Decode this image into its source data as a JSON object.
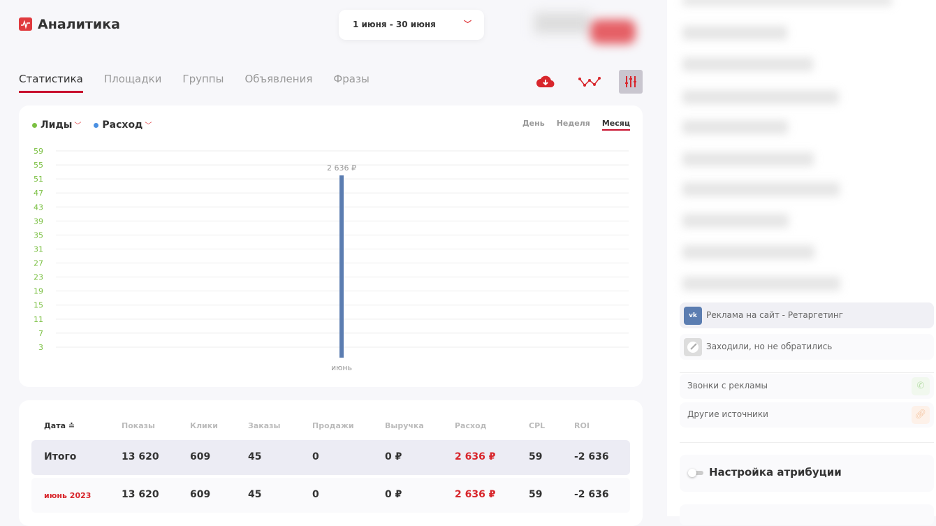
{
  "app": {
    "title": "Аналитика",
    "date_range": "1 июня - 30 июня"
  },
  "tabs": [
    {
      "label": "Статистика",
      "active": true
    },
    {
      "label": "Площадки"
    },
    {
      "label": "Группы"
    },
    {
      "label": "Объявления"
    },
    {
      "label": "Фразы"
    }
  ],
  "toolbar": {
    "icons": [
      "cloud-download-icon",
      "trend-line-icon",
      "sliders-icon"
    ]
  },
  "chart": {
    "legend": [
      {
        "label": "Лиды",
        "color": "#7bc043"
      },
      {
        "label": "Расход",
        "color": "#4a90e2"
      }
    ],
    "periods": [
      {
        "label": "День"
      },
      {
        "label": "Неделя"
      },
      {
        "label": "Месяц",
        "active": true
      }
    ]
  },
  "chart_data": {
    "type": "bar",
    "categories": [
      "июнь"
    ],
    "series": [
      {
        "name": "Расход",
        "values": [
          52
        ],
        "labels": [
          "2 636 ₽"
        ],
        "color": "#5b7db1"
      }
    ],
    "yticks": [
      59,
      55,
      51,
      47,
      43,
      39,
      35,
      31,
      27,
      23,
      19,
      15,
      11,
      7,
      3
    ],
    "ylim": [
      0,
      59
    ],
    "grid": true,
    "xlabel": "",
    "ylabel": ""
  },
  "table": {
    "headers": [
      "Дата",
      "Показы",
      "Клики",
      "Заказы",
      "Продажи",
      "Выручка",
      "Расход",
      "CPL",
      "ROI"
    ],
    "rows": [
      [
        "Итого",
        "13 620",
        "609",
        "45",
        "0",
        "0 ₽",
        "2 636 ₽",
        "59",
        "-2 636"
      ],
      [
        "июнь 2023",
        "13 620",
        "609",
        "45",
        "0",
        "0 ₽",
        "2 636 ₽",
        "59",
        "-2 636"
      ]
    ]
  },
  "sidebar": {
    "sources": [
      {
        "label": "Реклама на сайт - Ретаргетинг",
        "icon": "vk-icon"
      },
      {
        "label": "Заходили, но не обратились",
        "icon": "target-icon"
      }
    ],
    "other": [
      {
        "label": "Звонки с рекламы",
        "icon": "phone-icon"
      },
      {
        "label": "Другие источники",
        "icon": "link-icon"
      }
    ],
    "attribution": "Настройка атрибуции"
  }
}
